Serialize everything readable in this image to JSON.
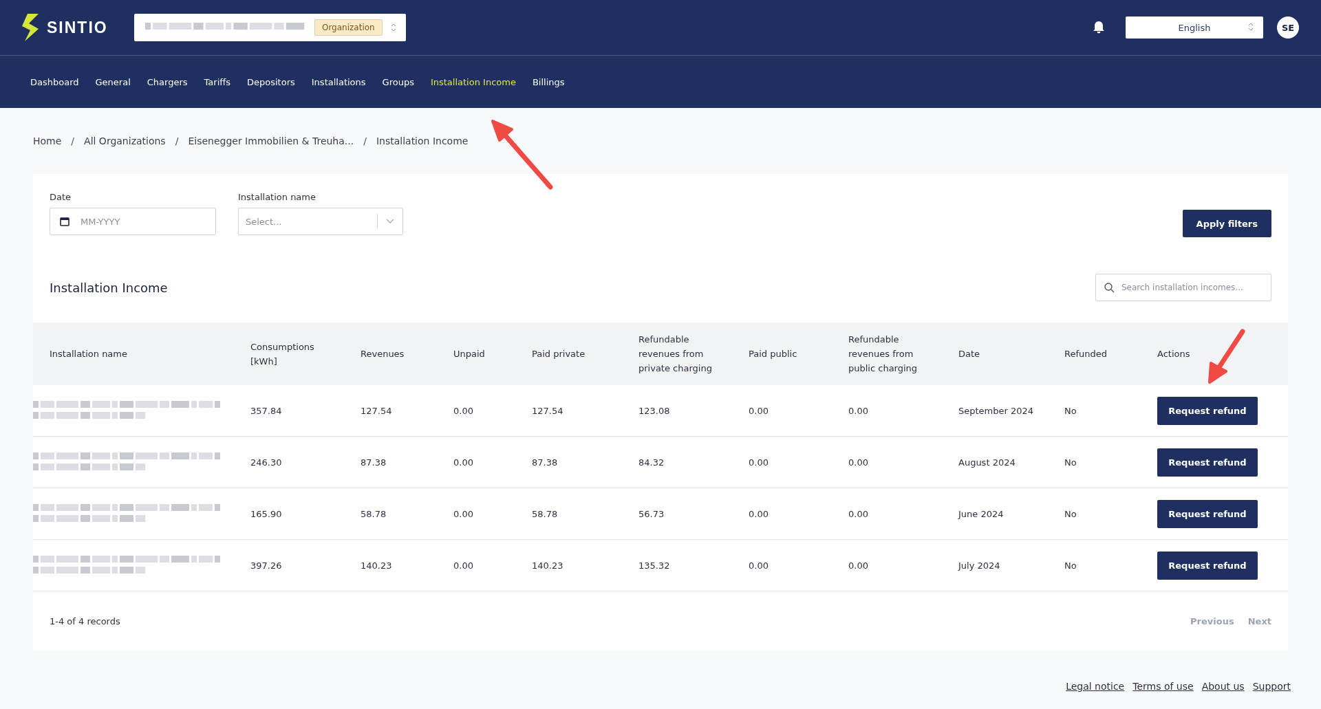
{
  "header": {
    "logo": "SINTIO",
    "org_badge": "Organization",
    "language": "English",
    "avatar": "SE"
  },
  "nav": [
    {
      "label": "Dashboard",
      "selected": false
    },
    {
      "label": "General",
      "selected": false
    },
    {
      "label": "Chargers",
      "selected": false
    },
    {
      "label": "Tariffs",
      "selected": false
    },
    {
      "label": "Depositors",
      "selected": false
    },
    {
      "label": "Installations",
      "selected": false
    },
    {
      "label": "Groups",
      "selected": false
    },
    {
      "label": "Installation Income",
      "selected": true
    },
    {
      "label": "Billings",
      "selected": false
    }
  ],
  "breadcrumb_separator": "/",
  "breadcrumb": [
    "Home",
    "All Organizations",
    "Eisenegger Immobilien & Treuha...",
    "Installation Income"
  ],
  "filters": {
    "date": {
      "label": "Date",
      "placeholder": "MM-YYYY"
    },
    "installation": {
      "label": "Installation name",
      "placeholder": "Select..."
    },
    "apply": "Apply filters"
  },
  "table": {
    "title": "Installation Income",
    "search_placeholder": "Search installation incomes...",
    "columns": [
      "Installation name",
      "Consumptions [kWh]",
      "Revenues",
      "Unpaid",
      "Paid private",
      "Refundable revenues from private charging",
      "Paid public",
      "Refundable revenues from public charging",
      "Date",
      "Refunded",
      "Actions"
    ],
    "rows": [
      {
        "cells": [
          "",
          "357.84",
          "127.54",
          "0.00",
          "127.54",
          "123.08",
          "0.00",
          "0.00",
          "September 2024",
          "No"
        ],
        "action": "Request refund"
      },
      {
        "cells": [
          "",
          "246.30",
          "87.38",
          "0.00",
          "87.38",
          "84.32",
          "0.00",
          "0.00",
          "August 2024",
          "No"
        ],
        "action": "Request refund"
      },
      {
        "cells": [
          "",
          "165.90",
          "58.78",
          "0.00",
          "58.78",
          "56.73",
          "0.00",
          "0.00",
          "June 2024",
          "No"
        ],
        "action": "Request refund"
      },
      {
        "cells": [
          "",
          "397.26",
          "140.23",
          "0.00",
          "140.23",
          "135.32",
          "0.00",
          "0.00",
          "July 2024",
          "No"
        ],
        "action": "Request refund"
      }
    ],
    "records": "1-4 of 4 records",
    "pager": [
      {
        "label": "Previous",
        "disabled": true
      },
      {
        "label": "Next",
        "disabled": true
      }
    ]
  },
  "footer_links": [
    "Legal notice",
    "Terms of use",
    "About us",
    "Support"
  ]
}
